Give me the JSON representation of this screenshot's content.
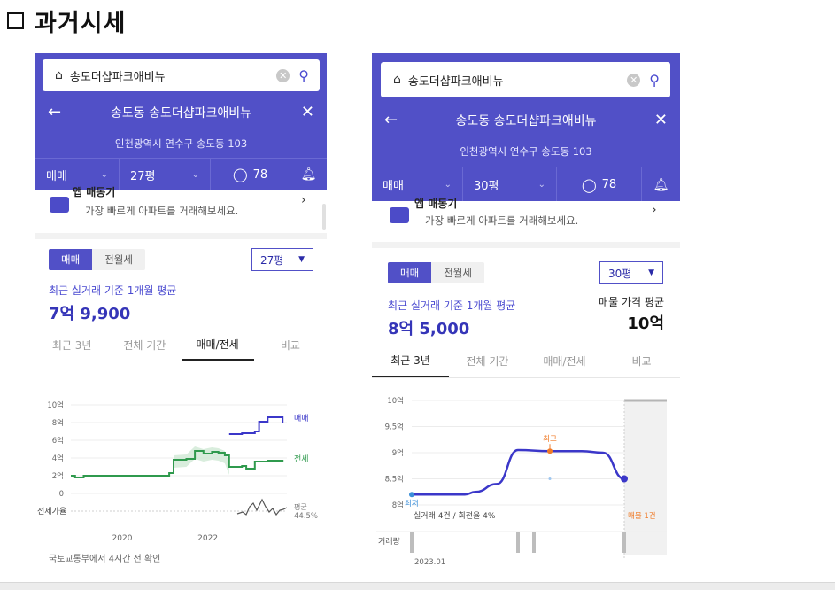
{
  "page": {
    "heading": "과거시세"
  },
  "left": {
    "search_text": "송도더샵파크애비뉴",
    "title": "송도동 송도더샵파크애비뉴",
    "address": "인천광역시 연수구 송도동 103",
    "filter_trade": "매매",
    "filter_size": "27평",
    "comment_count": "78",
    "banner_title": "앱 매동기",
    "banner_text": "가장 빠르게 아파트를 거래해보세요.",
    "seg_trade": "매매",
    "seg_rent": "전월세",
    "size_select": "27평",
    "avg_label": "최근 실거래 기준 1개월 평균",
    "avg_value": "7억 9,900",
    "tabs": [
      "최근 3년",
      "전체 기간",
      "매매/전세",
      "비교"
    ],
    "active_tab": 2,
    "legend_trade": "매매",
    "legend_jeonse": "전세",
    "row_label": "전세가율",
    "ratio_label": "평균",
    "ratio_value": "44.5%",
    "footer": "국토교통부에서 4시간 전 확인",
    "colors": {
      "trade": "#3b37c9",
      "jeonse": "#2f9a4d",
      "band": "#cfe9d4",
      "ratio": "#555555"
    }
  },
  "right": {
    "search_text": "송도더샵파크애비뉴",
    "title": "송도동 송도더샵파크애비뉴",
    "address": "인천광역시 연수구 송도동 103",
    "filter_trade": "매매",
    "filter_size": "30평",
    "comment_count": "78",
    "banner_title": "앱 매동기",
    "banner_text": "가장 빠르게 아파트를 거래해보세요.",
    "seg_trade": "매매",
    "seg_rent": "전월세",
    "size_select": "30평",
    "avg_label": "최근 실거래 기준 1개월 평균",
    "avg_value": "8억 5,000",
    "listing_label": "매물 가격 평균",
    "listing_value": "10억",
    "tabs": [
      "최근 3년",
      "전체 기간",
      "매매/전세",
      "비교"
    ],
    "active_tab": 0,
    "high_label": "최고",
    "low_label": "최저",
    "summary": "실거래 4건 / 회전율 4%",
    "listing_count": "매물 1건",
    "volume_label": "거래량",
    "colors": {
      "line": "#3b37c9",
      "high": "#f07b28",
      "listing": "#f07b28"
    }
  },
  "chart_data": [
    {
      "type": "line",
      "x_ticks": [
        "2020",
        "2022"
      ],
      "y_ticks": [
        "10억",
        "8억",
        "6억",
        "4억",
        "2억",
        "0"
      ],
      "ylim": [
        0,
        10
      ],
      "series": [
        {
          "name": "매매",
          "x": [
            2022.6,
            2022.9,
            2023.0,
            2023.2,
            2023.3,
            2023.5,
            2023.7,
            2023.85
          ],
          "y": [
            6.7,
            6.8,
            6.8,
            7.0,
            8.1,
            8.6,
            8.6,
            8.0
          ]
        },
        {
          "name": "전세",
          "x": [
            2018.9,
            2019.0,
            2019.2,
            2019.6,
            2020.0,
            2020.4,
            2020.8,
            2021.2,
            2021.3,
            2021.6,
            2021.8,
            2022.0,
            2022.2,
            2022.35,
            2022.5,
            2022.6,
            2022.9,
            2023.0,
            2023.2,
            2023.5,
            2023.85
          ],
          "y": [
            2.0,
            1.8,
            2.0,
            2.0,
            2.0,
            2.0,
            2.0,
            2.3,
            3.8,
            3.9,
            4.8,
            4.5,
            4.7,
            4.6,
            4.3,
            3.0,
            3.1,
            2.8,
            3.6,
            3.7,
            3.8
          ]
        }
      ]
    },
    {
      "type": "line",
      "x_ticks": [
        "2023.01"
      ],
      "y_ticks": [
        "10억",
        "9.5억",
        "9억",
        "8.5억",
        "8억"
      ],
      "ylim": [
        8,
        10
      ],
      "series": [
        {
          "x": [
            2023.0,
            2023.2,
            2023.4,
            2023.5,
            2023.6,
            2023.8,
            2024.0,
            2024.3,
            2024.5,
            2024.6,
            2024.8,
            2025.0
          ],
          "y": [
            8.2,
            8.2,
            8.2,
            8.2,
            8.25,
            8.4,
            9.05,
            9.03,
            9.03,
            9.03,
            9.0,
            8.5
          ]
        }
      ],
      "high": {
        "x": 2024.3,
        "y": 9.03
      },
      "low": {
        "x": 2023.0,
        "y": 8.2
      }
    }
  ]
}
